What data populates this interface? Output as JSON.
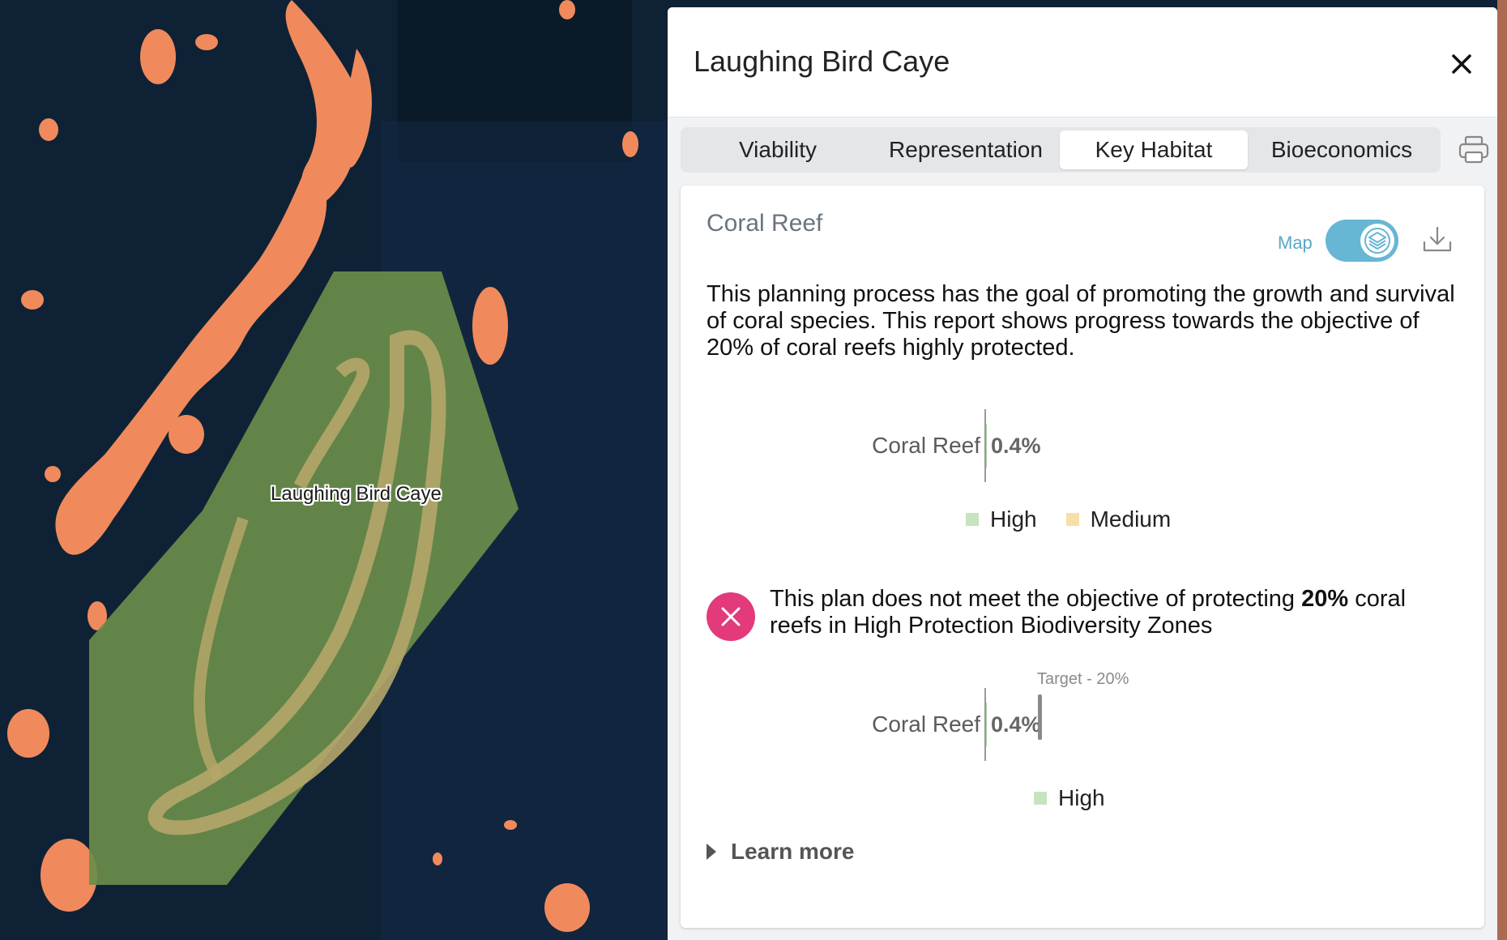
{
  "map": {
    "place_label": "Laughing Bird Caye",
    "colors": {
      "water": "#0f2235",
      "reef": "#f08a5d",
      "protected_zone": "#6a8d4a",
      "island": "#b5a66a"
    }
  },
  "panel": {
    "title": "Laughing Bird Caye",
    "close_icon": "close-icon",
    "tabs": [
      {
        "label": "Viability",
        "active": false
      },
      {
        "label": "Representation",
        "active": false
      },
      {
        "label": "Key Habitat",
        "active": true
      },
      {
        "label": "Bioeconomics",
        "active": false
      }
    ],
    "print_icon": "printer-icon"
  },
  "card": {
    "title": "Coral Reef",
    "map_toggle_label": "Map",
    "map_toggle_on": true,
    "download_icon": "download-icon",
    "description": "This planning process has the goal of promoting the growth and survival of coral species. This report shows progress towards the objective of 20% of coral reefs highly protected.",
    "chart1": {
      "label": "Coral Reef",
      "value_text": "0.4%",
      "legend": [
        {
          "label": "High",
          "color": "#c6e4c0"
        },
        {
          "label": "Medium",
          "color": "#f7dfa8"
        }
      ]
    },
    "objective": {
      "status": "not-met",
      "text_before": "This plan does not meet the objective of protecting ",
      "text_bold": "20%",
      "text_after": " coral reefs in High Protection Biodiversity Zones"
    },
    "chart2": {
      "label": "Coral Reef",
      "value_text": "0.4%",
      "target_label": "Target - 20%",
      "legend": [
        {
          "label": "High",
          "color": "#c6e4c0"
        }
      ]
    },
    "learn_more": "Learn more"
  },
  "chart_data": [
    {
      "type": "bar",
      "categories": [
        "Coral Reef"
      ],
      "series": [
        {
          "name": "High",
          "values": [
            0.4
          ]
        },
        {
          "name": "Medium",
          "values": [
            0
          ]
        }
      ],
      "value_label": "0.4%"
    },
    {
      "type": "bar",
      "categories": [
        "Coral Reef"
      ],
      "series": [
        {
          "name": "High",
          "values": [
            0.4
          ]
        }
      ],
      "value_label": "0.4%",
      "target": 20,
      "target_label": "Target - 20%"
    }
  ]
}
